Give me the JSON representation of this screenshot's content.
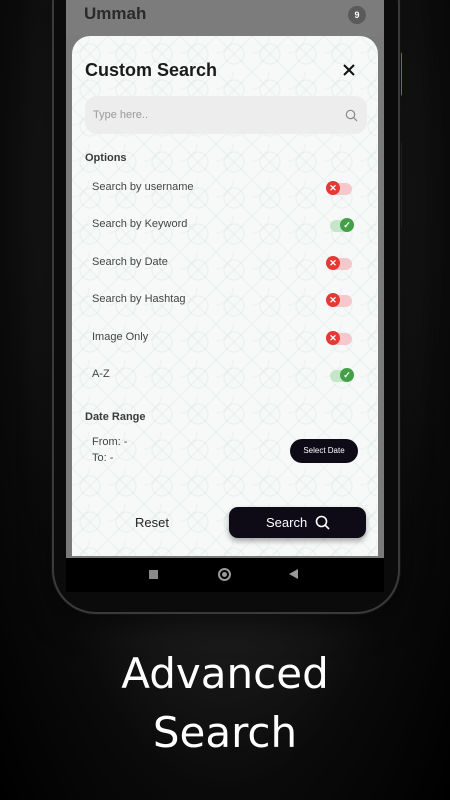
{
  "app": {
    "title": "Ummah",
    "badge_count": "9"
  },
  "sheet": {
    "title": "Custom Search",
    "search": {
      "placeholder": "Type here..",
      "value": ""
    },
    "options_label": "Options",
    "options": [
      {
        "label": "Search by username",
        "enabled": false
      },
      {
        "label": "Search by Keyword",
        "enabled": true
      },
      {
        "label": "Search by Date",
        "enabled": false
      },
      {
        "label": "Search by Hashtag",
        "enabled": false
      },
      {
        "label": "Image Only",
        "enabled": false
      },
      {
        "label": "A-Z",
        "enabled": true
      }
    ],
    "date_range": {
      "label": "Date Range",
      "from": "From: -",
      "to": "To: -",
      "select_button": "Select Date"
    },
    "reset_label": "Reset",
    "search_label": "Search"
  },
  "caption": {
    "line1": "Advanced",
    "line2": "Search"
  },
  "colors": {
    "accent_dark": "#0e0b17",
    "toggle_on": "#43a047",
    "toggle_off": "#e53935"
  }
}
